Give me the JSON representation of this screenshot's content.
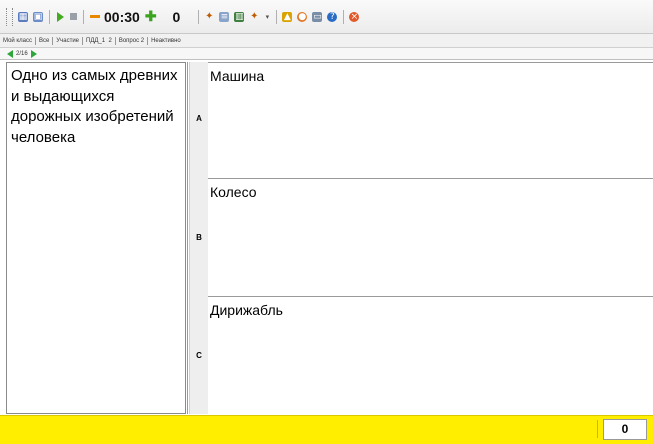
{
  "toolbar": {
    "timer": "00:30",
    "score": "0",
    "colors": {
      "minus": "#e88a00",
      "plus": "#3aa41f",
      "play": "#44aa22"
    },
    "icons": [
      "grip-icon",
      "grid-view-icon",
      "monitor-icon",
      "play-icon",
      "stop-icon",
      "minus-icon",
      "plus-icon",
      "pointer-icon",
      "document-icon",
      "chart-icon",
      "pointer-dropdown-icon",
      "lock-icon",
      "flag-icon",
      "window-icon",
      "help-icon",
      "exit-icon"
    ]
  },
  "info": {
    "class": "Мой класс",
    "group": "Все",
    "mode": "Участие",
    "test": "ПДД_1",
    "number": "2",
    "question": "Вопрос 2",
    "state": "Неактивно"
  },
  "nav": {
    "position": "2/16"
  },
  "question": {
    "text": "Одно из самых древних и выдающихся дорожных изобретений человека"
  },
  "answers": [
    {
      "letter": "A",
      "text": "Машина"
    },
    {
      "letter": "B",
      "text": "Колесо"
    },
    {
      "letter": "C",
      "text": "Дирижабль"
    }
  ],
  "status": {
    "counter": "0",
    "color": "#ffee00"
  }
}
